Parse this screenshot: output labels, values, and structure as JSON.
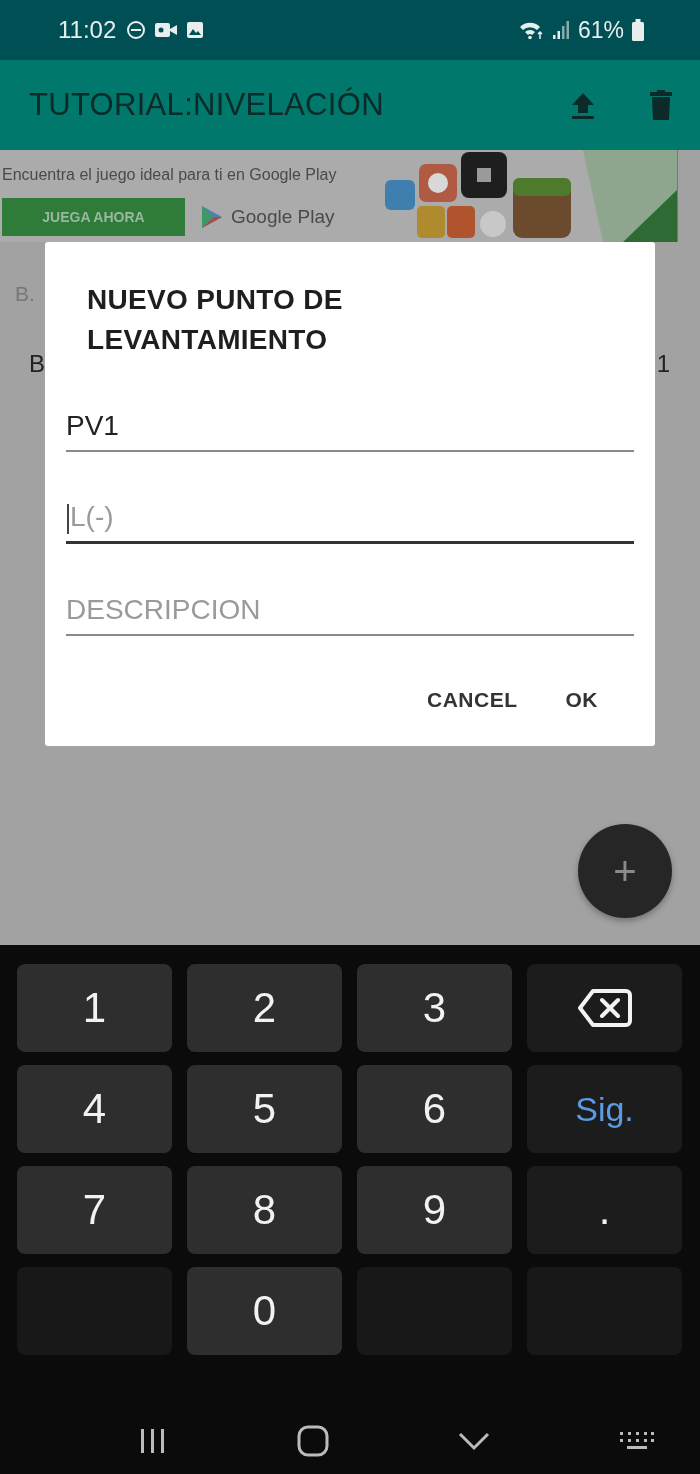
{
  "status_bar": {
    "time": "11:02",
    "battery": "61%"
  },
  "app_bar": {
    "title": "TUTORIAL:NIVELACIÓN"
  },
  "ad_banner": {
    "headline": "Encuentra el juego ideal para ti en Google Play",
    "button": "JUEGA AHORA",
    "store": "Google Play"
  },
  "background_list": {
    "header": "B.",
    "row_start": "B",
    "row_end": "1"
  },
  "dialog": {
    "title": "NUEVO PUNTO DE LEVANTAMIENTO",
    "fields": [
      {
        "value": "PV1",
        "focused": false
      },
      {
        "placeholder": "L(-)",
        "focused": true
      },
      {
        "placeholder": "DESCRIPCION",
        "focused": false
      }
    ],
    "buttons": [
      "CANCEL",
      "OK"
    ]
  },
  "fab": {
    "label": "+"
  },
  "keyboard": {
    "keys": [
      {
        "kind": "digit",
        "label": "1"
      },
      {
        "kind": "digit",
        "label": "2"
      },
      {
        "kind": "digit",
        "label": "3"
      },
      {
        "kind": "backspace"
      },
      {
        "kind": "digit",
        "label": "4"
      },
      {
        "kind": "digit",
        "label": "5"
      },
      {
        "kind": "digit",
        "label": "6"
      },
      {
        "kind": "action",
        "label": "Sig."
      },
      {
        "kind": "digit",
        "label": "7"
      },
      {
        "kind": "digit",
        "label": "8"
      },
      {
        "kind": "digit",
        "label": "9"
      },
      {
        "kind": "symbol",
        "label": "."
      },
      {
        "kind": "blank"
      },
      {
        "kind": "digit",
        "label": "0"
      },
      {
        "kind": "blank"
      },
      {
        "kind": "blank"
      }
    ]
  }
}
